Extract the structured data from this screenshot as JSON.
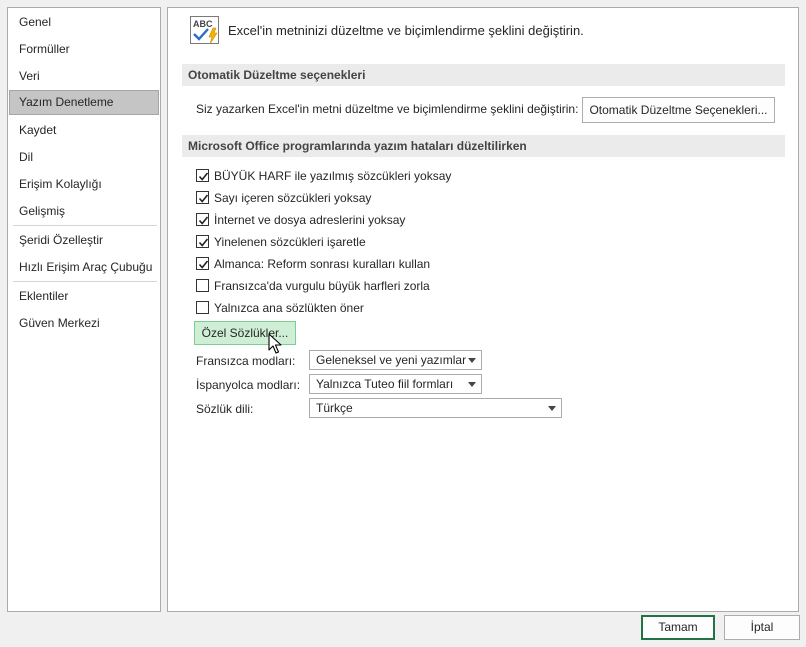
{
  "sidebar": {
    "items": [
      {
        "label": "Genel"
      },
      {
        "label": "Formüller"
      },
      {
        "label": "Veri"
      },
      {
        "label": "Yazım Denetleme",
        "selected": true
      },
      {
        "label": "Kaydet"
      },
      {
        "label": "Dil"
      },
      {
        "label": "Erişim Kolaylığı"
      },
      {
        "label": "Gelişmiş"
      },
      {
        "label": "Şeridi Özelleştir"
      },
      {
        "label": "Hızlı Erişim Araç Çubuğu"
      },
      {
        "label": "Eklentiler"
      },
      {
        "label": "Güven Merkezi"
      }
    ]
  },
  "header": {
    "icon": "abc-proofing-icon",
    "icon_text": "ABC",
    "text": "Excel'in metninizi düzeltme ve biçimlendirme şeklini değiştirin."
  },
  "autocorrect_section": {
    "title": "Otomatik Düzeltme seçenekleri",
    "label": "Siz yazarken Excel'in metni düzeltme ve biçimlendirme şeklini değiştirin:",
    "button_label": "Otomatik Düzeltme Seçenekleri..."
  },
  "spelling_section": {
    "title": "Microsoft Office programlarında yazım hataları düzeltilirken",
    "checkboxes": [
      {
        "label": "BÜYÜK HARF ile yazılmış sözcükleri yoksay",
        "checked": true
      },
      {
        "label": "Sayı içeren sözcükleri yoksay",
        "checked": true
      },
      {
        "label": "İnternet ve dosya adreslerini yoksay",
        "checked": true
      },
      {
        "label": "Yinelenen sözcükleri işaretle",
        "checked": true
      },
      {
        "label": "Almanca: Reform sonrası kuralları kullan",
        "checked": true
      },
      {
        "label": "Fransızca'da vurgulu büyük harfleri zorla",
        "checked": false
      },
      {
        "label": "Yalnızca ana sözlükten öner",
        "checked": false
      }
    ],
    "custom_dict_button": "Özel Sözlükler...",
    "french_modes_label": "Fransızca modları:",
    "french_modes_value": "Geleneksel ve yeni yazımlar",
    "spanish_modes_label": "İspanyolca modları:",
    "spanish_modes_value": "Yalnızca Tuteo fiil formları",
    "dict_lang_label": "Sözlük dili:",
    "dict_lang_value": "Türkçe"
  },
  "footer": {
    "ok_label": "Tamam",
    "cancel_label": "İptal"
  },
  "colors": {
    "accent": "#217346",
    "selected_nav": "#c5c5c5",
    "hover_button": "#cfeed6"
  }
}
